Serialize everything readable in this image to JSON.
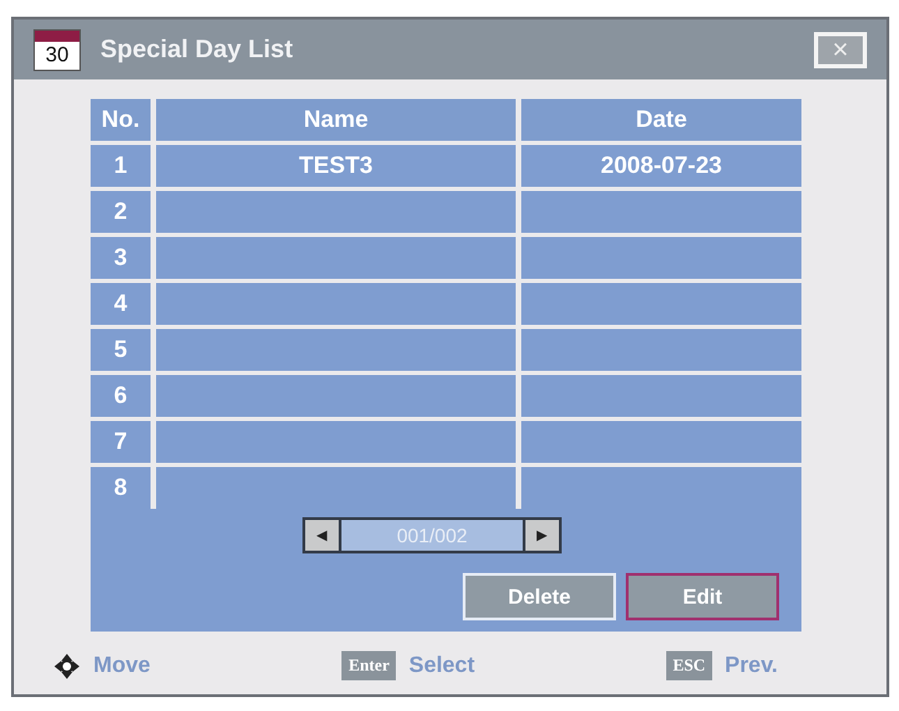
{
  "window": {
    "title": "Special Day List",
    "icon_text": "30",
    "close": "×"
  },
  "table": {
    "columns": [
      "No.",
      "Name",
      "Date"
    ],
    "rows": [
      {
        "no": "1",
        "name": "TEST3",
        "date": "2008-07-23"
      },
      {
        "no": "2"
      },
      {
        "no": "3"
      },
      {
        "no": "4"
      },
      {
        "no": "5"
      },
      {
        "no": "6"
      },
      {
        "no": "7"
      },
      {
        "no": "8"
      }
    ]
  },
  "pager": {
    "prev": "◀",
    "page": "001/002",
    "next": "▶"
  },
  "buttons": [
    {
      "label": "Delete",
      "selected": false
    },
    {
      "label": "Edit",
      "selected": true
    }
  ],
  "legend": [
    {
      "kind": "dpad",
      "label": "Move"
    },
    {
      "kind": "key",
      "key": "Enter",
      "label": "Select"
    },
    {
      "kind": "key",
      "key": "ESC",
      "label": "Prev."
    }
  ]
}
